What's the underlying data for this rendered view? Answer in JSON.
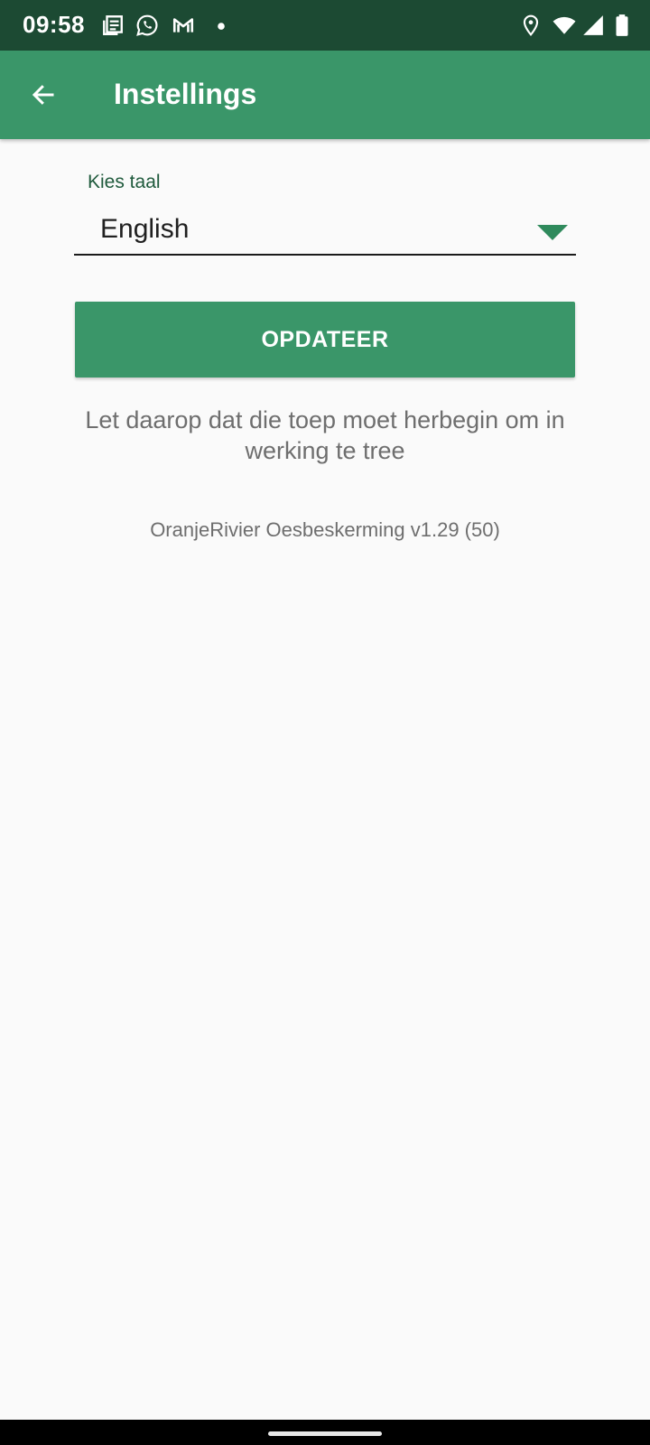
{
  "status_bar": {
    "time": "09:58",
    "notification_icons": [
      "news-icon",
      "whatsapp-icon",
      "gmail-icon",
      "more-dot-icon"
    ],
    "system_icons": [
      "location-icon",
      "wifi-icon",
      "signal-icon",
      "battery-icon"
    ]
  },
  "app_bar": {
    "back_icon": "arrow-left-icon",
    "title": "Instellings"
  },
  "language": {
    "label": "Kies taal",
    "selected": "English"
  },
  "update_button": {
    "label": "OPDATEER"
  },
  "note": "Let daarop dat die toep moet herbegin om in werking te tree",
  "version": "OranjeRivier Oesbeskerming v1.29 (50)",
  "colors": {
    "status_bar": "#1c4a33",
    "primary": "#3a9669",
    "background": "#fafafa",
    "label": "#1f5a3c"
  }
}
